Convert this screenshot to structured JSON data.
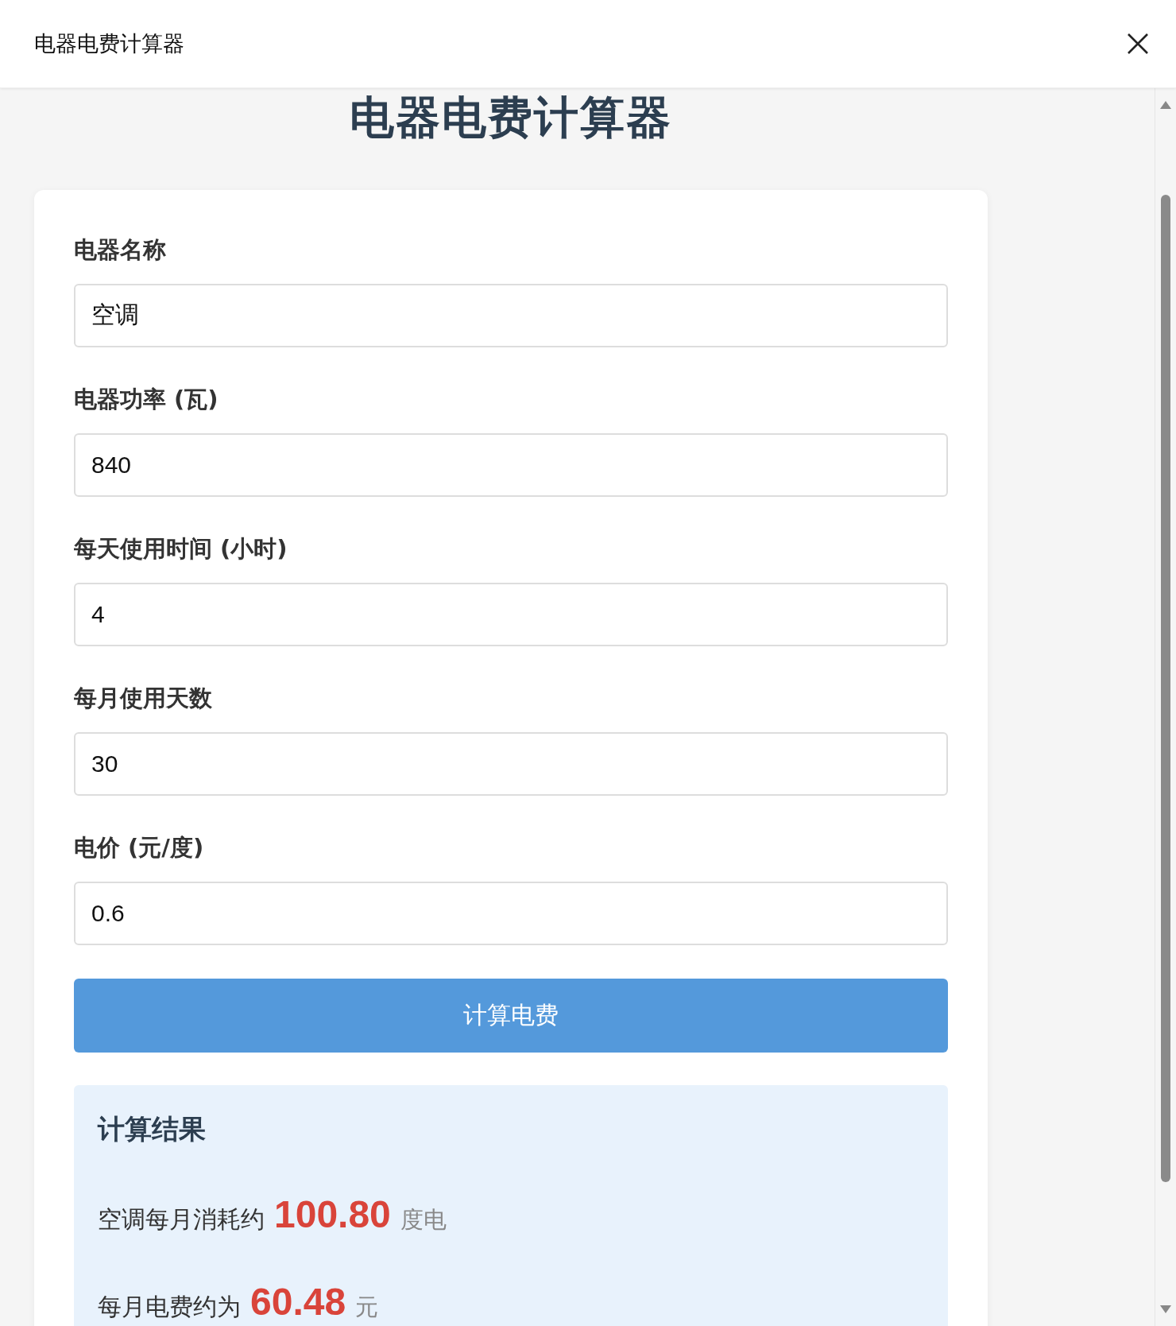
{
  "window": {
    "title": "电器电费计算器"
  },
  "heading": "电器电费计算器",
  "fields": [
    {
      "label": "电器名称",
      "value": "空调"
    },
    {
      "label": "电器功率 (瓦)",
      "value": "840"
    },
    {
      "label": "每天使用时间 (小时)",
      "value": "4"
    },
    {
      "label": "每月使用天数",
      "value": "30"
    },
    {
      "label": "电价 (元/度)",
      "value": "0.6"
    }
  ],
  "button": "计算电费",
  "result": {
    "title": "计算结果",
    "lines": [
      {
        "text": "空调每月消耗约",
        "value": "100.80",
        "unit": "度电"
      },
      {
        "text": "每月电费约为",
        "value": "60.48",
        "unit": "元"
      }
    ]
  }
}
